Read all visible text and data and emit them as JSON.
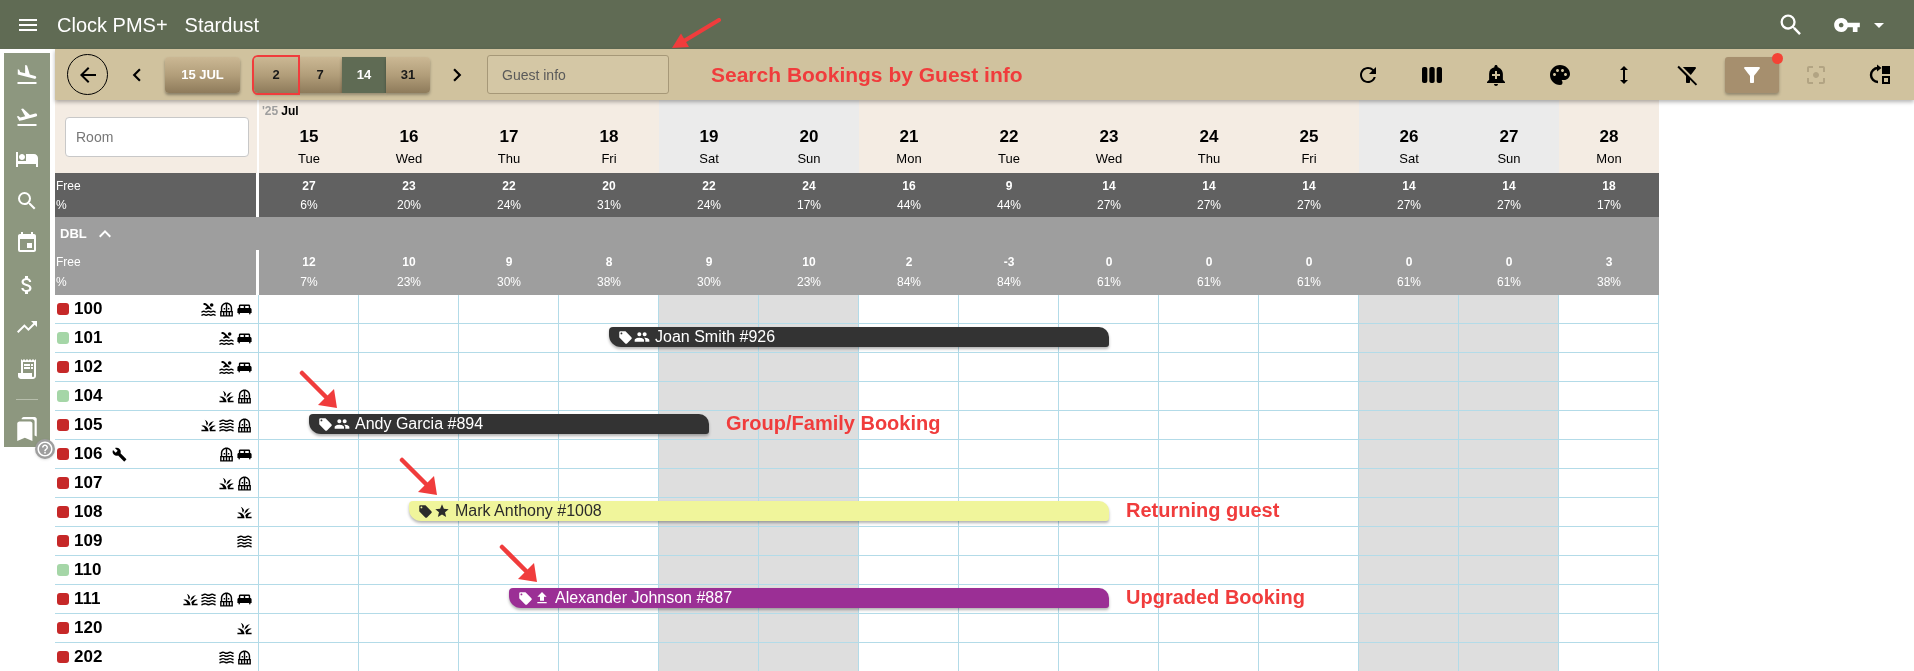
{
  "app": {
    "title": "Clock PMS+",
    "property": "Stardust"
  },
  "toolbar": {
    "date_button": "15 JUL",
    "spans": [
      {
        "label": "2",
        "selected": false,
        "outlined": true
      },
      {
        "label": "7",
        "selected": false,
        "outlined": false
      },
      {
        "label": "14",
        "selected": true,
        "outlined": false
      },
      {
        "label": "31",
        "selected": false,
        "outlined": false
      }
    ],
    "search": {
      "placeholder": "Guest info",
      "annotation": "Search Bookings by Guest info"
    },
    "tools": [
      {
        "selected": false,
        "disabled": false,
        "indicator": false
      },
      {
        "selected": false,
        "disabled": false,
        "indicator": false
      },
      {
        "selected": false,
        "disabled": false,
        "indicator": false
      },
      {
        "selected": false,
        "disabled": false,
        "indicator": false
      },
      {
        "selected": false,
        "disabled": false,
        "indicator": false
      },
      {
        "selected": false,
        "disabled": false,
        "indicator": false
      },
      {
        "selected": true,
        "disabled": false,
        "indicator": true
      },
      {
        "selected": false,
        "disabled": true,
        "indicator": false
      },
      {
        "selected": false,
        "disabled": false,
        "indicator": false
      }
    ]
  },
  "calendar": {
    "year": "'25",
    "month": "Jul",
    "room_filter": {
      "placeholder": "Room"
    },
    "days": [
      {
        "day": "15",
        "weekday": "Tue",
        "weekend": false
      },
      {
        "day": "16",
        "weekday": "Wed",
        "weekend": false
      },
      {
        "day": "17",
        "weekday": "Thu",
        "weekend": false
      },
      {
        "day": "18",
        "weekday": "Fri",
        "weekend": false
      },
      {
        "day": "19",
        "weekday": "Sat",
        "weekend": true
      },
      {
        "day": "20",
        "weekday": "Sun",
        "weekend": true
      },
      {
        "day": "21",
        "weekday": "Mon",
        "weekend": false
      },
      {
        "day": "22",
        "weekday": "Tue",
        "weekend": false
      },
      {
        "day": "23",
        "weekday": "Wed",
        "weekend": false
      },
      {
        "day": "24",
        "weekday": "Thu",
        "weekend": false
      },
      {
        "day": "25",
        "weekday": "Fri",
        "weekend": false
      },
      {
        "day": "26",
        "weekday": "Sat",
        "weekend": true
      },
      {
        "day": "27",
        "weekday": "Sun",
        "weekend": true
      },
      {
        "day": "28",
        "weekday": "Mon",
        "weekend": false
      }
    ],
    "totals": {
      "free_label": "Free",
      "percent_label": "%",
      "values": [
        {
          "free": "27",
          "percent": "6%"
        },
        {
          "free": "23",
          "percent": "20%"
        },
        {
          "free": "22",
          "percent": "24%"
        },
        {
          "free": "20",
          "percent": "31%"
        },
        {
          "free": "22",
          "percent": "24%"
        },
        {
          "free": "24",
          "percent": "17%"
        },
        {
          "free": "16",
          "percent": "44%"
        },
        {
          "free": "9",
          "percent": "44%"
        },
        {
          "free": "14",
          "percent": "27%"
        },
        {
          "free": "14",
          "percent": "27%"
        },
        {
          "free": "14",
          "percent": "27%"
        },
        {
          "free": "14",
          "percent": "27%"
        },
        {
          "free": "14",
          "percent": "27%"
        },
        {
          "free": "18",
          "percent": "17%"
        }
      ]
    },
    "groups": [
      {
        "name": "DBL",
        "expanded": true,
        "free_label": "Free",
        "percent_label": "%",
        "values": [
          {
            "free": "12",
            "percent": "7%"
          },
          {
            "free": "10",
            "percent": "23%"
          },
          {
            "free": "9",
            "percent": "30%"
          },
          {
            "free": "8",
            "percent": "38%"
          },
          {
            "free": "9",
            "percent": "30%"
          },
          {
            "free": "10",
            "percent": "23%"
          },
          {
            "free": "2",
            "percent": "84%"
          },
          {
            "free": "-3",
            "percent": "84%"
          },
          {
            "free": "0",
            "percent": "61%"
          },
          {
            "free": "0",
            "percent": "61%"
          },
          {
            "free": "0",
            "percent": "61%"
          },
          {
            "free": "0",
            "percent": "61%"
          },
          {
            "free": "0",
            "percent": "61%"
          },
          {
            "free": "3",
            "percent": "38%"
          }
        ],
        "rooms": [
          {
            "number": "100",
            "color": "#c62828",
            "maintenance": false,
            "amenities": [
              {
                "kind": "pool"
              },
              {
                "kind": "balcony"
              },
              {
                "kind": "bed"
              }
            ]
          },
          {
            "number": "101",
            "color": "#a5d6a7",
            "maintenance": false,
            "amenities": [
              {
                "kind": "pool"
              },
              {
                "kind": "bed"
              }
            ],
            "nights": [
              {
                "kind": "free"
              },
              {
                "kind": "free"
              },
              {
                "kind": "free"
              },
              {
                "kind": "booked"
              },
              {
                "kind": "booked"
              },
              {
                "kind": "booked"
              },
              {
                "kind": "booked"
              },
              {
                "kind": "booked"
              },
              {
                "kind": "free"
              },
              {
                "kind": "free"
              },
              {
                "kind": "free"
              },
              {
                "kind": "free"
              },
              {
                "kind": "free"
              },
              {
                "kind": "free"
              }
            ],
            "bookings": [
              {
                "guest": "Joan Smith #926",
                "kind": "group",
                "color": "#333333"
              }
            ]
          },
          {
            "number": "102",
            "color": "#c62828",
            "maintenance": false,
            "amenities": [
              {
                "kind": "pool"
              },
              {
                "kind": "bed"
              }
            ]
          },
          {
            "number": "104",
            "color": "#a5d6a7",
            "maintenance": false,
            "amenities": [
              {
                "kind": "grass"
              },
              {
                "kind": "balcony"
              }
            ]
          },
          {
            "number": "105",
            "color": "#c62828",
            "maintenance": false,
            "amenities": [
              {
                "kind": "grass"
              },
              {
                "kind": "waves"
              },
              {
                "kind": "balcony"
              }
            ],
            "nights": [
              {
                "kind": "booked"
              },
              {
                "kind": "booked"
              },
              {
                "kind": "booked"
              },
              {
                "kind": "booked"
              },
              {
                "kind": "free"
              },
              {
                "kind": "free"
              },
              {
                "kind": "free"
              },
              {
                "kind": "free"
              },
              {
                "kind": "free"
              },
              {
                "kind": "free"
              },
              {
                "kind": "free"
              },
              {
                "kind": "free"
              },
              {
                "kind": "free"
              },
              {
                "kind": "free"
              }
            ],
            "bookings": [
              {
                "guest": "Andy Garcia #894",
                "kind": "group",
                "color": "#333333",
                "annotation": "Group/Family Booking"
              }
            ]
          },
          {
            "number": "106",
            "color": "#c62828",
            "maintenance": true,
            "amenities": [
              {
                "kind": "balcony"
              },
              {
                "kind": "bed"
              }
            ]
          },
          {
            "number": "107",
            "color": "#c62828",
            "maintenance": false,
            "amenities": [
              {
                "kind": "grass"
              },
              {
                "kind": "balcony"
              }
            ]
          },
          {
            "number": "108",
            "color": "#c62828",
            "maintenance": false,
            "amenities": [
              {
                "kind": "grass"
              }
            ],
            "nights": [
              {
                "kind": "free"
              },
              {
                "kind": "booked"
              },
              {
                "kind": "booked"
              },
              {
                "kind": "booked"
              },
              {
                "kind": "booked"
              },
              {
                "kind": "booked"
              },
              {
                "kind": "booked"
              },
              {
                "kind": "booked"
              },
              {
                "kind": "free"
              },
              {
                "kind": "free"
              },
              {
                "kind": "free"
              },
              {
                "kind": "free"
              },
              {
                "kind": "free"
              },
              {
                "kind": "free"
              }
            ],
            "bookings": [
              {
                "guest": "Mark Anthony #1008",
                "kind": "returning",
                "color": "#f0f59b",
                "annotation": "Returning guest"
              }
            ]
          },
          {
            "number": "109",
            "color": "#c62828",
            "maintenance": false,
            "amenities": [
              {
                "kind": "waves"
              }
            ]
          },
          {
            "number": "110",
            "color": "#a5d6a7",
            "maintenance": false
          },
          {
            "number": "111",
            "color": "#c62828",
            "maintenance": false,
            "amenities": [
              {
                "kind": "grass"
              },
              {
                "kind": "waves"
              },
              {
                "kind": "balcony"
              },
              {
                "kind": "bed"
              }
            ],
            "nights": [
              {
                "kind": "free"
              },
              {
                "kind": "free"
              },
              {
                "kind": "booked"
              },
              {
                "kind": "booked"
              },
              {
                "kind": "booked"
              },
              {
                "kind": "booked"
              },
              {
                "kind": "booked"
              },
              {
                "kind": "booked"
              },
              {
                "kind": "free"
              },
              {
                "kind": "free"
              },
              {
                "kind": "free"
              },
              {
                "kind": "free"
              },
              {
                "kind": "free"
              },
              {
                "kind": "free"
              }
            ],
            "bookings": [
              {
                "guest": "Alexander Johnson #887",
                "kind": "upgraded",
                "color": "#9b2f95",
                "annotation": "Upgraded Booking"
              }
            ]
          },
          {
            "number": "120",
            "color": "#c62828",
            "maintenance": false,
            "amenities": [
              {
                "kind": "grass"
              }
            ]
          },
          {
            "number": "202",
            "color": "#c62828",
            "maintenance": false,
            "amenities": [
              {
                "kind": "waves"
              },
              {
                "kind": "balcony"
              }
            ]
          }
        ]
      }
    ]
  }
}
